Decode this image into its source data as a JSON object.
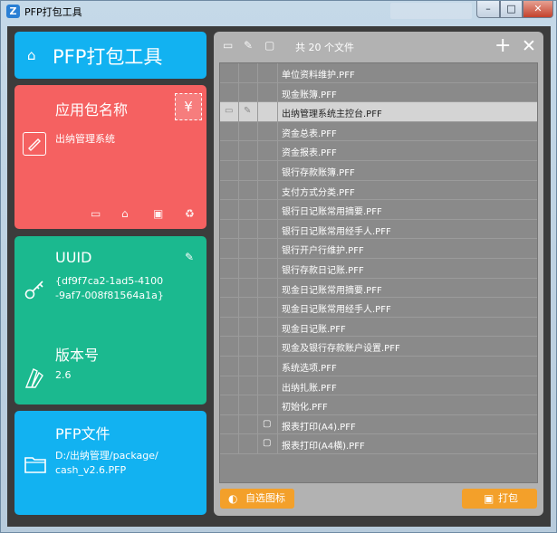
{
  "window": {
    "app_icon": "Z",
    "title": "PFP打包工具",
    "minimize": "–",
    "maximize": "□",
    "close": "✕"
  },
  "header": {
    "home_icon": "⌂",
    "title": "PFP打包工具"
  },
  "app_tile": {
    "heading": "应用包名称",
    "value": "出纳管理系统"
  },
  "uuid_tile": {
    "heading": "UUID",
    "value_line1": "{df9f7ca2-1ad5-4100",
    "value_line2": "-9af7-008f81564a1a}",
    "version_heading": "版本号",
    "version_value": "2.6"
  },
  "pfp_tile": {
    "heading": "PFP文件",
    "path_line1": "D:/出纳管理/package/",
    "path_line2": "cash_v2.6.PFP"
  },
  "toolbar": {
    "count": "共 20 个文件",
    "add": "+",
    "remove": "✕"
  },
  "files": [
    {
      "name": "单位资料维护.PFF",
      "selected": false,
      "boxed": false
    },
    {
      "name": "现金账簿.PFF",
      "selected": false,
      "boxed": false
    },
    {
      "name": "出纳管理系统主控台.PFF",
      "selected": true,
      "boxed": false
    },
    {
      "name": "资金总表.PFF",
      "selected": false,
      "boxed": false
    },
    {
      "name": "资金报表.PFF",
      "selected": false,
      "boxed": false
    },
    {
      "name": "银行存款账簿.PFF",
      "selected": false,
      "boxed": false
    },
    {
      "name": "支付方式分类.PFF",
      "selected": false,
      "boxed": false
    },
    {
      "name": "银行日记账常用摘要.PFF",
      "selected": false,
      "boxed": false
    },
    {
      "name": "银行日记账常用经手人.PFF",
      "selected": false,
      "boxed": false
    },
    {
      "name": "银行开户行维护.PFF",
      "selected": false,
      "boxed": false
    },
    {
      "name": "银行存款日记账.PFF",
      "selected": false,
      "boxed": false
    },
    {
      "name": "现金日记账常用摘要.PFF",
      "selected": false,
      "boxed": false
    },
    {
      "name": "现金日记账常用经手人.PFF",
      "selected": false,
      "boxed": false
    },
    {
      "name": "现金日记账.PFF",
      "selected": false,
      "boxed": false
    },
    {
      "name": "现金及银行存款账户设置.PFF",
      "selected": false,
      "boxed": false
    },
    {
      "name": "系统选项.PFF",
      "selected": false,
      "boxed": false
    },
    {
      "name": "出纳扎账.PFF",
      "selected": false,
      "boxed": false
    },
    {
      "name": "初始化.PFF",
      "selected": false,
      "boxed": false
    },
    {
      "name": "报表打印(A4).PFF",
      "selected": false,
      "boxed": true
    },
    {
      "name": "报表打印(A4横).PFF",
      "selected": false,
      "boxed": true
    }
  ],
  "buttons": {
    "choose_icon": "自选图标",
    "pack": "打包"
  },
  "colors": {
    "header_blue": "#12b2f1",
    "app_red": "#f56161",
    "uuid_green": "#1bb98f",
    "button_orange": "#f3a02a",
    "panel_gray": "#b2b2b2"
  }
}
